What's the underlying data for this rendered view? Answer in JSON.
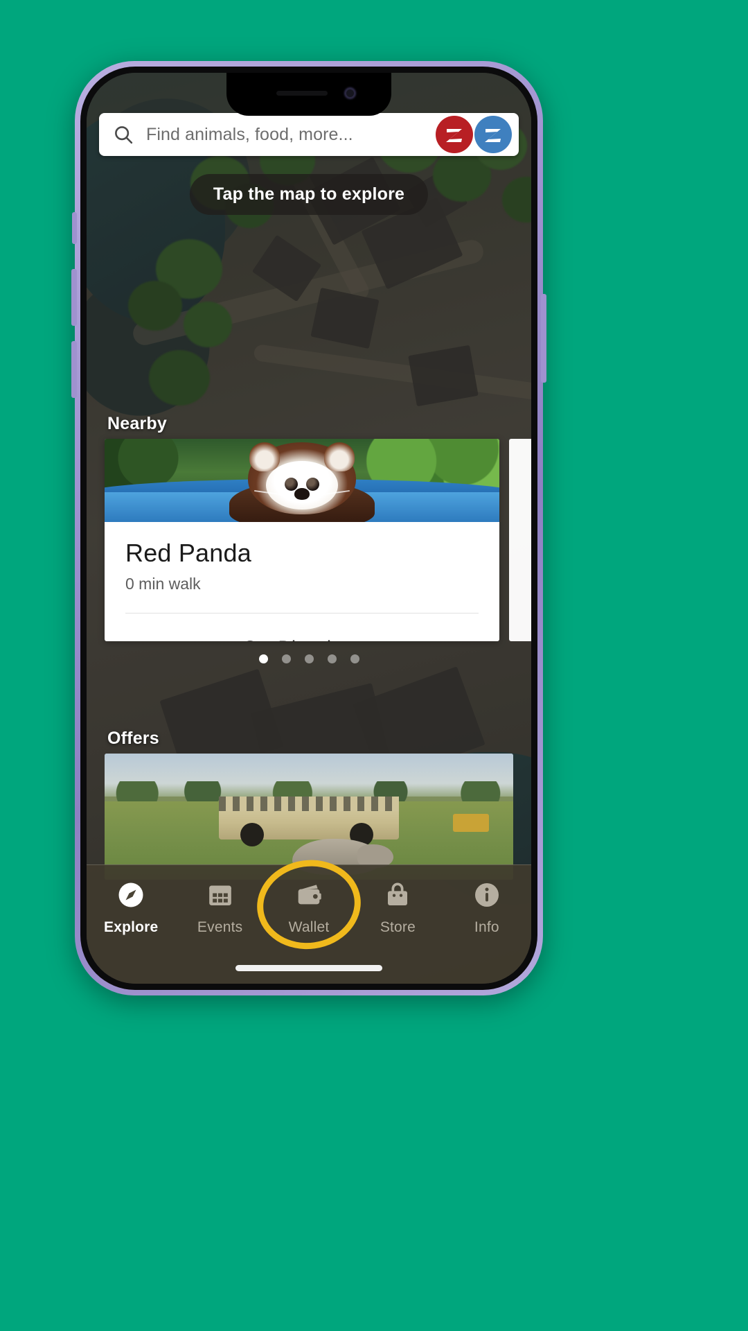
{
  "device": {
    "frame_color": "#9f92cf",
    "notch": {
      "camera": "front-camera",
      "speaker": "earpiece-speaker"
    }
  },
  "app": {
    "search": {
      "placeholder": "Find animals, food, more...",
      "value": "",
      "icon": "search-icon",
      "logos": [
        {
          "name": "zoo-logo-red",
          "letter": "Z",
          "color": "#b81f24"
        },
        {
          "name": "zoo-logo-blue",
          "letter": "Z",
          "color": "#3f80bf"
        }
      ]
    },
    "hint_banner": {
      "label": "Tap the map to explore"
    },
    "nearby": {
      "title": "Nearby",
      "cards": [
        {
          "title": "Red Panda",
          "subtitle": "0 min walk",
          "action_label": "Get Directions",
          "image": "red-panda-photo"
        }
      ],
      "pagination": {
        "count": 5,
        "active_index": 0
      }
    },
    "offers": {
      "title": "Offers",
      "cards": [
        {
          "image": "safari-bus-rhino-photo"
        }
      ]
    },
    "tabbar": {
      "active": "Explore",
      "highlighted": "Wallet",
      "highlight_color": "#f0b91c",
      "items": [
        {
          "label": "Explore",
          "icon": "compass-icon"
        },
        {
          "label": "Events",
          "icon": "calendar-icon"
        },
        {
          "label": "Wallet",
          "icon": "wallet-icon"
        },
        {
          "label": "Store",
          "icon": "shopping-bag-icon"
        },
        {
          "label": "Info",
          "icon": "info-icon"
        }
      ]
    }
  }
}
